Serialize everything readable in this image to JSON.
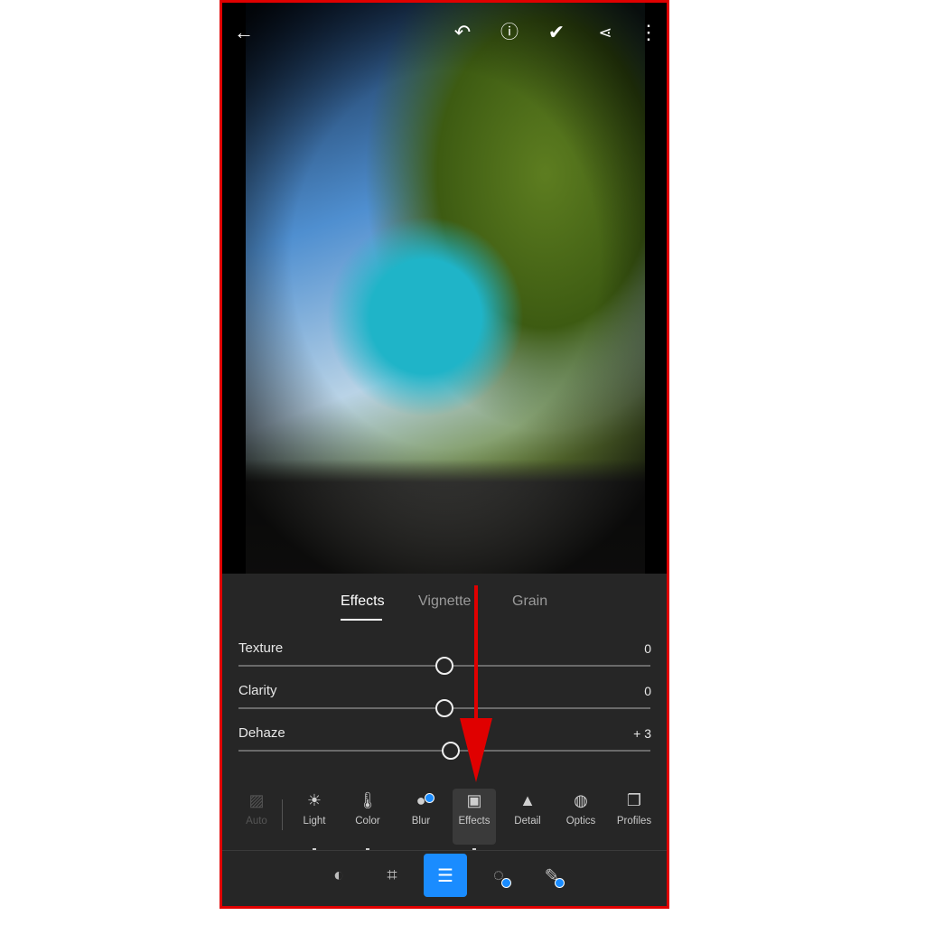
{
  "topbar": {
    "icons": [
      "back-arrow-icon",
      "undo-icon",
      "help-icon",
      "check-icon",
      "share-icon",
      "more-icon"
    ]
  },
  "tabs": [
    {
      "label": "Effects",
      "active": true
    },
    {
      "label": "Vignette",
      "active": false
    },
    {
      "label": "Grain",
      "active": false
    }
  ],
  "sliders": [
    {
      "label": "Texture",
      "value": "0",
      "level": 0
    },
    {
      "label": "Clarity",
      "value": "0",
      "level": 0
    },
    {
      "label": "Dehaze",
      "value": "+ 3",
      "level": 3
    }
  ],
  "tools": [
    {
      "label": "Auto",
      "icon": "auto-icon",
      "disabled": true
    },
    {
      "label": "Light",
      "icon": "sun-icon"
    },
    {
      "label": "Color",
      "icon": "thermometer-icon"
    },
    {
      "label": "Blur",
      "icon": "blur-drop-icon",
      "premium": true
    },
    {
      "label": "Effects",
      "icon": "effects-icon",
      "selected": true
    },
    {
      "label": "Detail",
      "icon": "detail-triangle-icon"
    },
    {
      "label": "Optics",
      "icon": "lens-icon"
    },
    {
      "label": "Profiles",
      "icon": "profiles-icon"
    }
  ],
  "bottom_nav": [
    "presets-icon",
    "crop-icon",
    "edit-sliders-icon",
    "masking-icon",
    "healing-icon"
  ],
  "colors": {
    "accent": "#1a8cff",
    "annotation": "#e00000",
    "panel": "#262626"
  }
}
